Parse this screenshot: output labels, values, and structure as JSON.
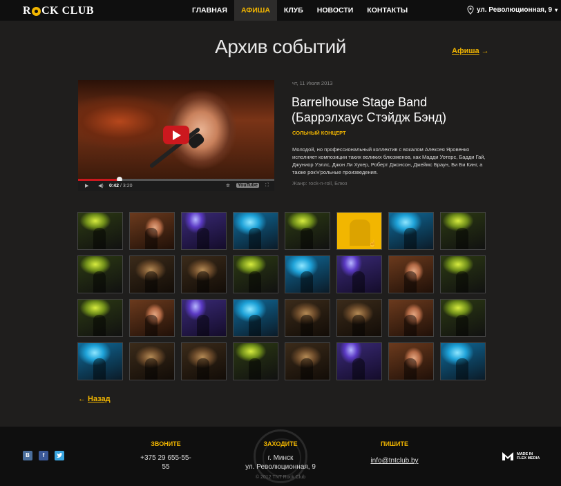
{
  "header": {
    "logo": "ROCK CLUB",
    "logo_left": "R",
    "logo_right": "CK CLUB",
    "nav": [
      "ГЛАВНАЯ",
      "АФИША",
      "КЛУБ",
      "НОВОСТИ",
      "КОНТАКТЫ"
    ],
    "active_nav": "АФИША",
    "address": "ул. Революционная, 9"
  },
  "page": {
    "title": "Архив событий",
    "afisha_link": "Афиша",
    "back_link": "Назад"
  },
  "video": {
    "current_time": "0:42",
    "duration": "3:20",
    "progress": 0.21,
    "provider": "YouTube"
  },
  "event": {
    "date": "чт, 11 Июля 2013",
    "title": "Barrelhouse Stage Band (Баррэлхаус Стэйдж Бэнд)",
    "type": "СОЛЬНЫЙ КОНЦЕРТ",
    "description": "Молодой, но профессиональный коллектив с вокалом Алексея Яровенко исполняет композиции таких великих блюзменов, как Мадди Уотерс, Бадди Гай, Джуниор Уэллс, Джон Ли Хукер, Роберт Джонсон, Джеймс Браун, Би Би Кинг, а также рок'н'рольные произведения.",
    "genre": "Жанр: rock-n-roll, Блюз"
  },
  "gallery": {
    "rows": 4,
    "cols": 8,
    "selected_index": 5,
    "thumbs": [
      "green",
      "face",
      "purple",
      "blue",
      "green",
      "yellow",
      "blue",
      "green",
      "green",
      "crowd",
      "crowd",
      "green",
      "blue",
      "purple",
      "face",
      "green",
      "green",
      "face",
      "purple",
      "blue",
      "crowd",
      "crowd",
      "face",
      "green",
      "blue",
      "crowd",
      "crowd",
      "green",
      "crowd",
      "purple",
      "face",
      "blue"
    ]
  },
  "footer": {
    "call_head": "ЗВОНИТЕ",
    "phone": "+375 29 655-55-55",
    "visit_head": "ЗАХОДИТЕ",
    "city": "г. Минск",
    "street": "ул. Революционная, 9",
    "write_head": "ПИШИТЕ",
    "email": "info@tntclub.by",
    "copyright": "© 2012 TNT Rock Club",
    "made_in": "MADE IN",
    "flex_media": "FLEX MEDIA",
    "social": [
      "В",
      "f",
      "twitter"
    ]
  },
  "colors": {
    "accent": "#f2b600",
    "background": "#1f1e1d",
    "header_bg": "#0f0f0f",
    "youtube_red": "#cc181e"
  }
}
